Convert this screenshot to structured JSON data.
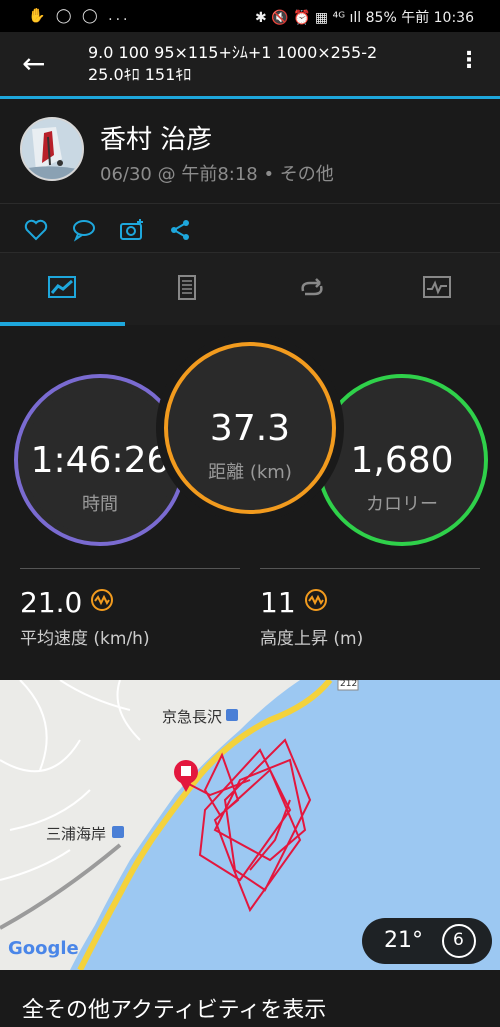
{
  "status": {
    "left_icons": "✋ ◯ ◯ ...",
    "battery": "85%",
    "time": "午前 10:36",
    "right_prefix": "✱ 🔇 ⏰ ▦ ⁴ᴳ ıll"
  },
  "appbar": {
    "title_line1": "9.0 100 95×115+ｼﾑ+1 1000×255-2",
    "title_line2": "25.0ｷﾛ 151ｷﾛ"
  },
  "header": {
    "name": "香村 治彦",
    "subtitle": "06/30 @ 午前8:18 • その他"
  },
  "stats": {
    "time": {
      "value": "1:46:26",
      "label": "時間"
    },
    "distance": {
      "value": "37.3",
      "label": "距離 (km)"
    },
    "calories": {
      "value": "1,680",
      "label": "カロリー"
    },
    "avg_speed": {
      "value": "21.0",
      "label": "平均速度 (km/h)"
    },
    "elevation": {
      "value": "11",
      "label": "高度上昇 (m)"
    }
  },
  "map": {
    "station1": "京急長沢",
    "station2": "三浦海岸",
    "route_num": "212",
    "google": "Google",
    "temp": "21°",
    "wind": "6"
  },
  "footer": {
    "label": "全その他アクティビティを表示"
  },
  "colors": {
    "accent": "#1ea7dc",
    "time_ring": "#7a6bd1",
    "distance_ring": "#f29b1e",
    "calorie_ring": "#2fd14a",
    "track": "#e3173e"
  }
}
